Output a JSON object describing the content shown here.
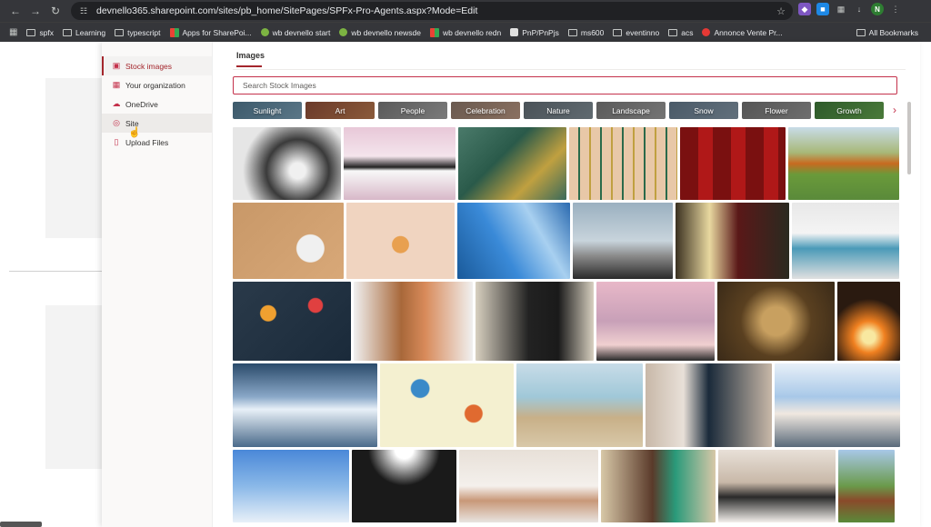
{
  "browser": {
    "url": "devnello365.sharepoint.com/sites/pb_home/SitePages/SPFx-Pro-Agents.aspx?Mode=Edit",
    "profile_initial": "N",
    "bookmarks": [
      "spfx",
      "Learning",
      "typescript",
      "Apps for SharePoi...",
      "wb devnello start",
      "wb devnello newsde",
      "wb devnello redn",
      "PnP/PnPjs",
      "ms600",
      "eventinno",
      "acs",
      "Annonce Vente Pr..."
    ],
    "all_bookmarks_label": "All Bookmarks"
  },
  "side_nav": {
    "items": [
      {
        "label": "Stock images",
        "icon": "image-icon",
        "active": true
      },
      {
        "label": "Your organization",
        "icon": "building-icon",
        "active": false
      },
      {
        "label": "OneDrive",
        "icon": "cloud-icon",
        "active": false
      },
      {
        "label": "Site",
        "icon": "globe-icon",
        "active": false
      },
      {
        "label": "Upload Files",
        "icon": "upload-icon",
        "active": false
      }
    ]
  },
  "content": {
    "tab_label": "Images",
    "search_placeholder": "Search Stock Images",
    "categories": [
      "Sunlight",
      "Art",
      "People",
      "Celebration",
      "Nature",
      "Landscape",
      "Snow",
      "Flower",
      "Growth"
    ]
  },
  "colors": {
    "accent": "#a4262c",
    "search_border": "#c4314b"
  }
}
